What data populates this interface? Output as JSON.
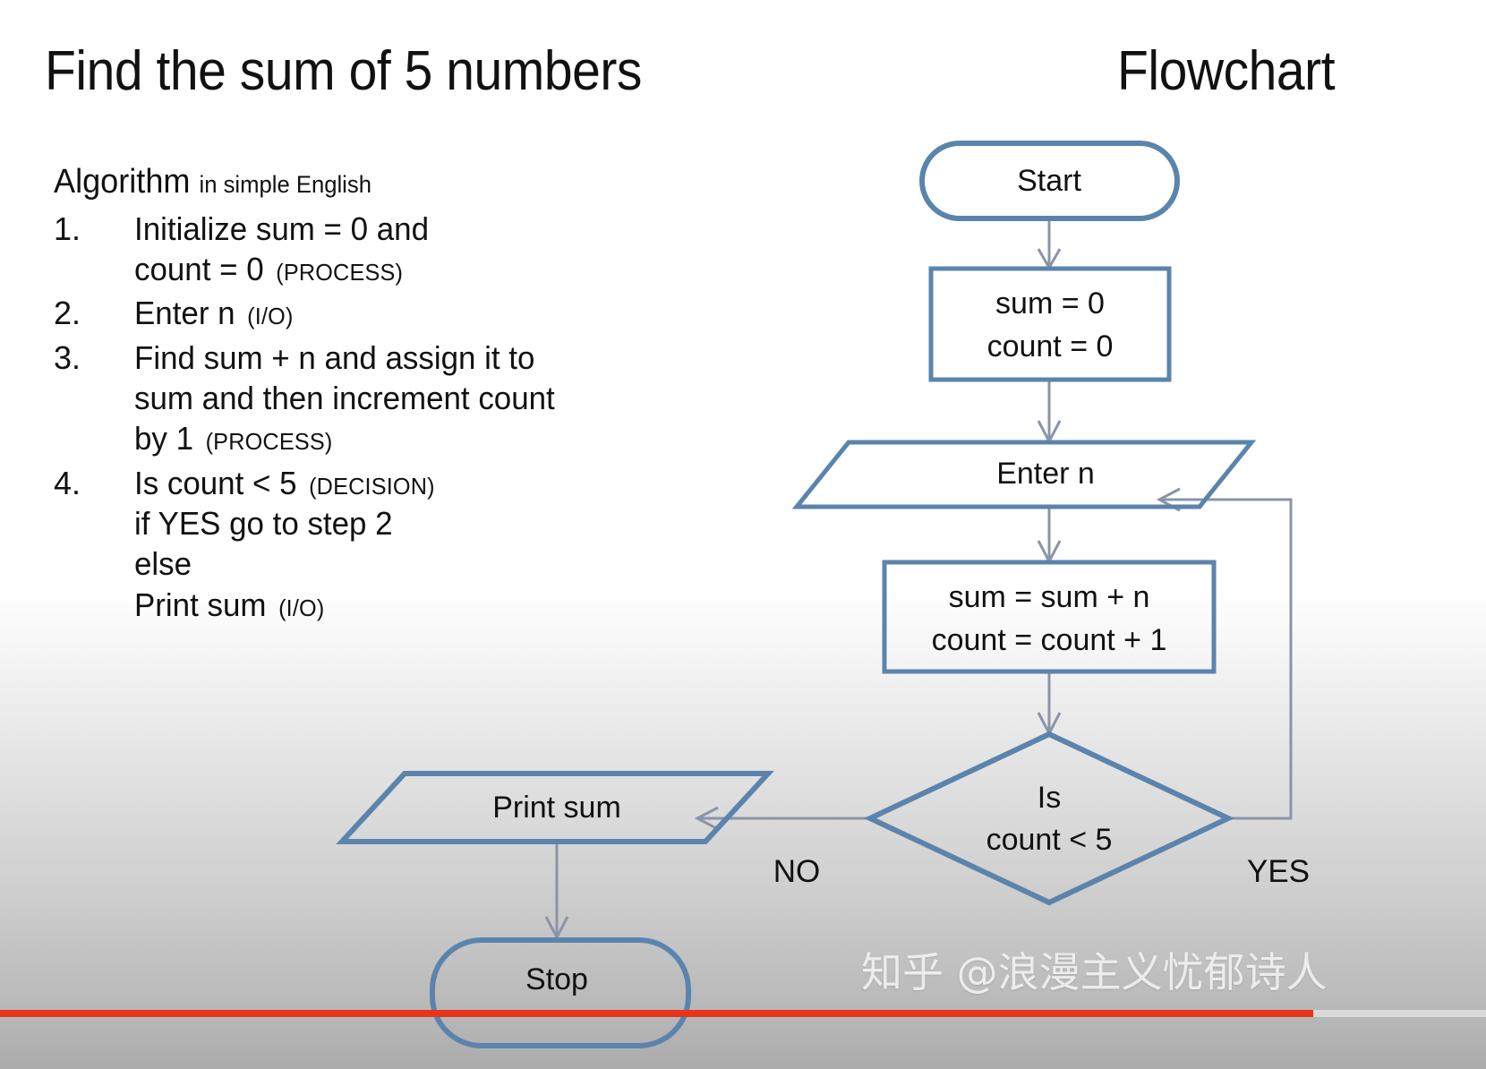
{
  "slide": {
    "title": "Find the sum of 5 numbers",
    "title_right": "Flowchart"
  },
  "algorithm": {
    "heading_strong": "Algorithm",
    "heading_sub": "in simple English",
    "steps": [
      {
        "number": "1.",
        "lines": [
          {
            "text": "Initialize sum = 0 and",
            "tag": ""
          },
          {
            "text": "count = 0",
            "tag": "(PROCESS)"
          }
        ]
      },
      {
        "number": "2.",
        "lines": [
          {
            "text": "Enter n",
            "tag": "(I/O)"
          }
        ]
      },
      {
        "number": "3.",
        "lines": [
          {
            "text": "Find sum + n and assign it to",
            "tag": ""
          },
          {
            "text": "sum and then increment count",
            "tag": ""
          },
          {
            "text": "by 1",
            "tag": "(PROCESS)"
          }
        ]
      },
      {
        "number": "4.",
        "lines": [
          {
            "text": "Is count < 5",
            "tag": "(DECISION)"
          },
          {
            "text": "if YES go to step 2",
            "tag": ""
          },
          {
            "text": "else",
            "tag": ""
          },
          {
            "text": "Print sum",
            "tag": "(I/O)"
          }
        ]
      }
    ]
  },
  "flowchart": {
    "type": "flowchart",
    "shape_stroke_color": "#5b84ad",
    "connector_color": "#8b94a6",
    "nodes": [
      {
        "id": "start",
        "shape": "terminator",
        "label": "Start"
      },
      {
        "id": "init",
        "shape": "process",
        "line1": "sum = 0",
        "line2": "count = 0"
      },
      {
        "id": "input",
        "shape": "parallelogram",
        "label": "Enter n"
      },
      {
        "id": "accum",
        "shape": "process",
        "line1": "sum = sum + n",
        "line2": "count = count + 1"
      },
      {
        "id": "decision",
        "shape": "diamond",
        "line1": "Is",
        "line2": "count < 5"
      },
      {
        "id": "output",
        "shape": "parallelogram",
        "label": "Print sum"
      },
      {
        "id": "stop",
        "shape": "terminator",
        "label": "Stop"
      }
    ],
    "edges": [
      {
        "from": "start",
        "to": "init",
        "label": ""
      },
      {
        "from": "init",
        "to": "input",
        "label": ""
      },
      {
        "from": "input",
        "to": "accum",
        "label": ""
      },
      {
        "from": "accum",
        "to": "decision",
        "label": ""
      },
      {
        "from": "decision",
        "to": "output",
        "label": "NO"
      },
      {
        "from": "decision",
        "to": "input",
        "label": "YES"
      },
      {
        "from": "output",
        "to": "stop",
        "label": ""
      }
    ],
    "branch_no": "NO",
    "branch_yes": "YES"
  },
  "watermark": {
    "text": "知乎 @浪漫主义忧郁诗人"
  },
  "player": {
    "progress_percent": 88
  }
}
